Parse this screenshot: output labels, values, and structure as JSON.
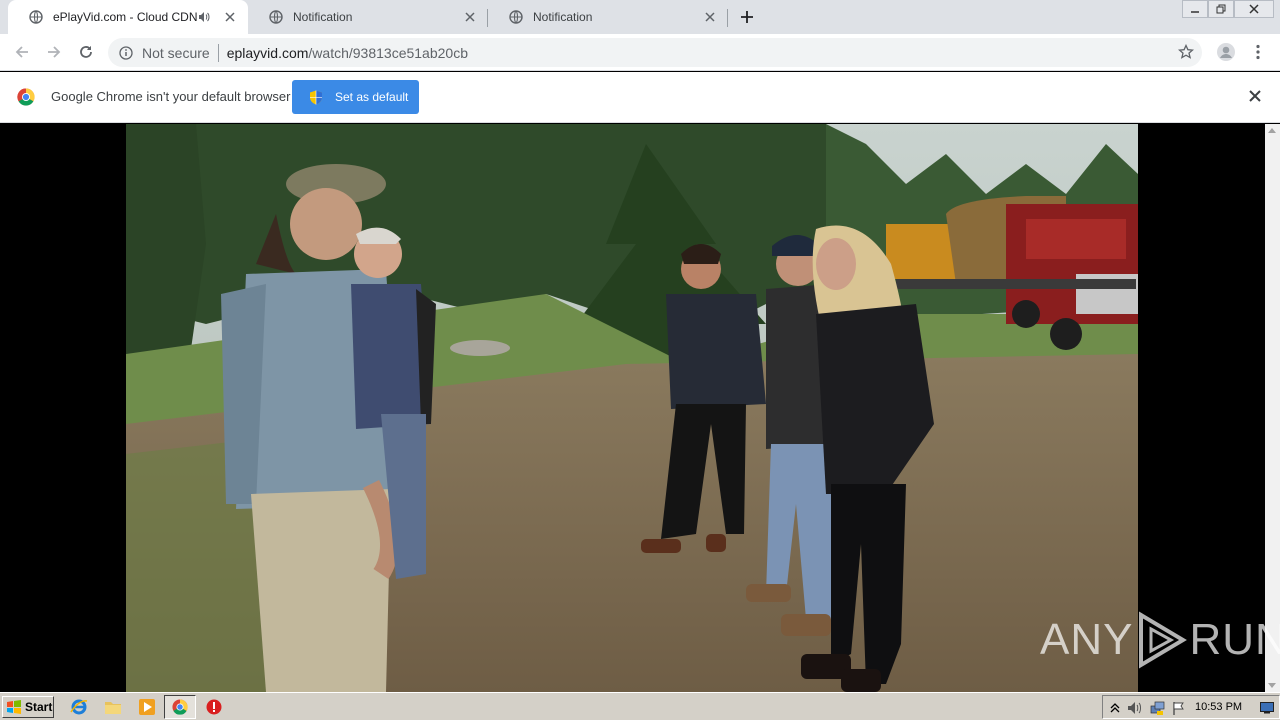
{
  "browser": {
    "tabs": [
      {
        "title": "ePlayVid.com - Cloud CDN",
        "active": true,
        "audio": true
      },
      {
        "title": "Notification",
        "active": false,
        "audio": false
      },
      {
        "title": "Notification",
        "active": false,
        "audio": false
      }
    ],
    "address": {
      "security_label": "Not secure",
      "host": "eplayvid.com",
      "path": "/watch/93813ce51ab20cb"
    }
  },
  "infobar": {
    "message": "Google Chrome isn't your default browser",
    "button_label": "Set as default"
  },
  "watermark": {
    "left": "ANY",
    "right": "RUN"
  },
  "taskbar": {
    "start_label": "Start",
    "clock": "10:53 PM"
  },
  "colors": {
    "accent": "#3b8ae6",
    "tabstrip": "#dee1e6",
    "taskbar": "#d4d0c8"
  }
}
